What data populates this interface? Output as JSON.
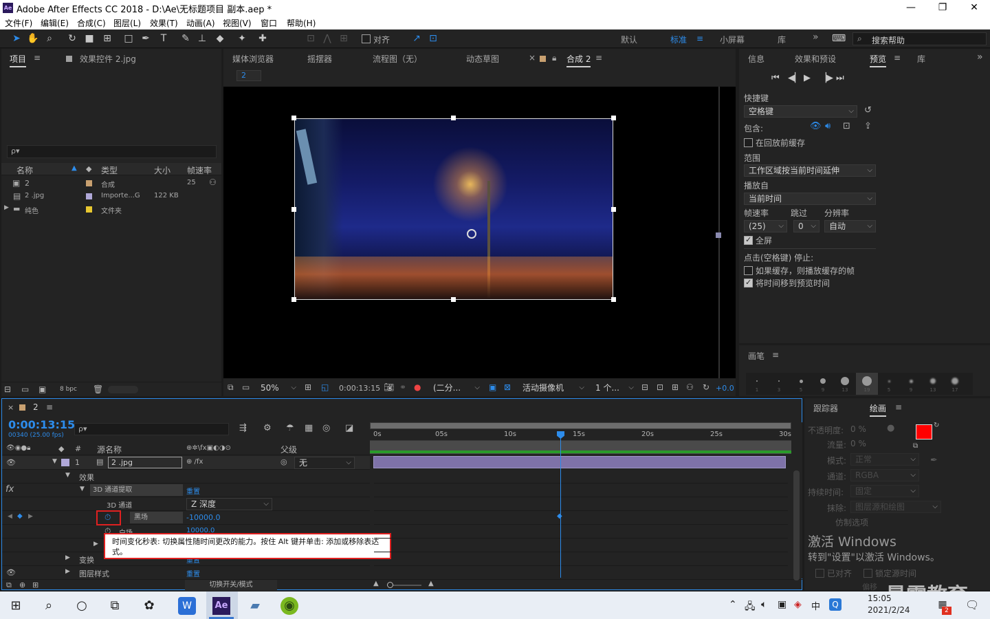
{
  "window": {
    "app_badge": "Ae",
    "title": "Adobe After Effects CC 2018 - D:\\Ae\\无标题项目 副本.aep *",
    "minimize": "—",
    "restore": "❐",
    "close": "✕"
  },
  "menu": [
    "文件(F)",
    "编辑(E)",
    "合成(C)",
    "图层(L)",
    "效果(T)",
    "动画(A)",
    "视图(V)",
    "窗口",
    "帮助(H)"
  ],
  "toolbar": {
    "snap_label": "对齐",
    "workspaces": [
      "默认",
      "标准",
      "小屏幕",
      "库"
    ],
    "active_workspace": "标准",
    "more": "»",
    "search_placeholder": "搜索帮助"
  },
  "project_panel": {
    "tab_project": "项目",
    "tab_effects": "效果控件 2.jpg",
    "search_glyph": "ρ▾",
    "columns": {
      "name": "名称",
      "type": "类型",
      "size": "大小",
      "fps": "帧速率"
    },
    "items": [
      {
        "name": "2",
        "type": "合成",
        "size": "",
        "fps": "25",
        "color": "#c8a070"
      },
      {
        "name": "2 .jpg",
        "type": "Importe...G",
        "size": "122 KB",
        "fps": "",
        "color": "#b0a8d8"
      },
      {
        "name": "纯色",
        "type": "文件夹",
        "size": "",
        "fps": "",
        "color": "#e8c830"
      }
    ],
    "bpc": "8 bpc"
  },
  "viewer": {
    "tabs": [
      "媒体浏览器",
      "摇摆器",
      "流程图（无）",
      "动态草图"
    ],
    "comp_tab": "合成 2",
    "comp_chip": "2",
    "zoom": "50%",
    "timecode": "0:00:13:15",
    "resolution": "(二分...",
    "camera": "活动摄像机",
    "views": "1 个...",
    "exposure": "+0.0"
  },
  "preview_panel": {
    "tabs": [
      "信息",
      "效果和预设",
      "预览",
      "库"
    ],
    "active_tab": "预览",
    "more": "»",
    "shortcut_label": "快捷键",
    "shortcut_value": "空格键",
    "include_label": "包含:",
    "cache_before_label": "在回放前缓存",
    "range_label": "范围",
    "range_value": "工作区域按当前时间延伸",
    "play_from_label": "播放自",
    "play_from_value": "当前时间",
    "fps_label": "帧速率",
    "skip_label": "跳过",
    "res_label": "分辨率",
    "fps_value": "(25)",
    "skip_value": "0",
    "res_value": "自动",
    "fullscreen_label": "全屏",
    "stop_label": "点击(空格键) 停止:",
    "if_cached_label": "如果缓存，则播放缓存的帧",
    "move_time_label": "将时间移到预览时间"
  },
  "brush_panel": {
    "title": "画笔",
    "sizes": [
      "1",
      "3",
      "5",
      "9",
      "13",
      "19",
      "5",
      "9",
      "13",
      "17"
    ]
  },
  "timeline": {
    "comp_tab": "2",
    "timecode": "0:00:13:15",
    "frames_fps": "00340 (25.00 fps)",
    "search_glyph": "ρ▾",
    "cols": {
      "num": "#",
      "source": "源名称",
      "parent": "父级"
    },
    "ruler": [
      "0s",
      "05s",
      "10s",
      "15s",
      "20s",
      "25s",
      "30s"
    ],
    "layer": {
      "num": "1",
      "name": "2 .jpg",
      "parent": "无"
    },
    "effects_label": "效果",
    "fx_label": "fx",
    "effect_name": "3D 通道提取",
    "reset": "重置",
    "channel_label": "3D 通道",
    "channel_value": "Z 深度",
    "black_label": "黑场",
    "black_value": "-10000.0",
    "white_label": "白场",
    "white_value": "10000.0",
    "transform_label": "变换",
    "layer_style_label": "图层样式",
    "tooltip": "时间变化秒表: 切换属性随时间更改的能力。按住 Alt 键并单击: 添加或移除表达式。",
    "mode_toggle": "切换开关/模式"
  },
  "tracker_panel": {
    "tab_tracker": "跟踪器",
    "tab_paint": "绘画",
    "opacity_label": "不透明度:",
    "opacity_value": "0 %",
    "flow_label": "流量:",
    "flow_value": "0 %",
    "mode_label": "模式:",
    "mode_value": "正常",
    "channel_label": "通道:",
    "channel_value": "RGBA",
    "duration_label": "持续时间:",
    "duration_value": "固定",
    "erase_label": "抹除:",
    "erase_value": "图层源和绘图",
    "clone_label": "仿制选项",
    "aligned_label": "已对齐",
    "lock_label": "锁定源时间",
    "offset_label": "偏移",
    "fg_color": "#ff0000",
    "bg_color": "#ffffff"
  },
  "watermark": {
    "line1": "激活 Windows",
    "line2": "转到\"设置\"以激活 Windows。",
    "brand": "最需教育"
  },
  "taskbar": {
    "time": "15:05",
    "date": "2021/2/24",
    "ime": "中",
    "ae_label": "Ae",
    "notification_count": "2"
  }
}
